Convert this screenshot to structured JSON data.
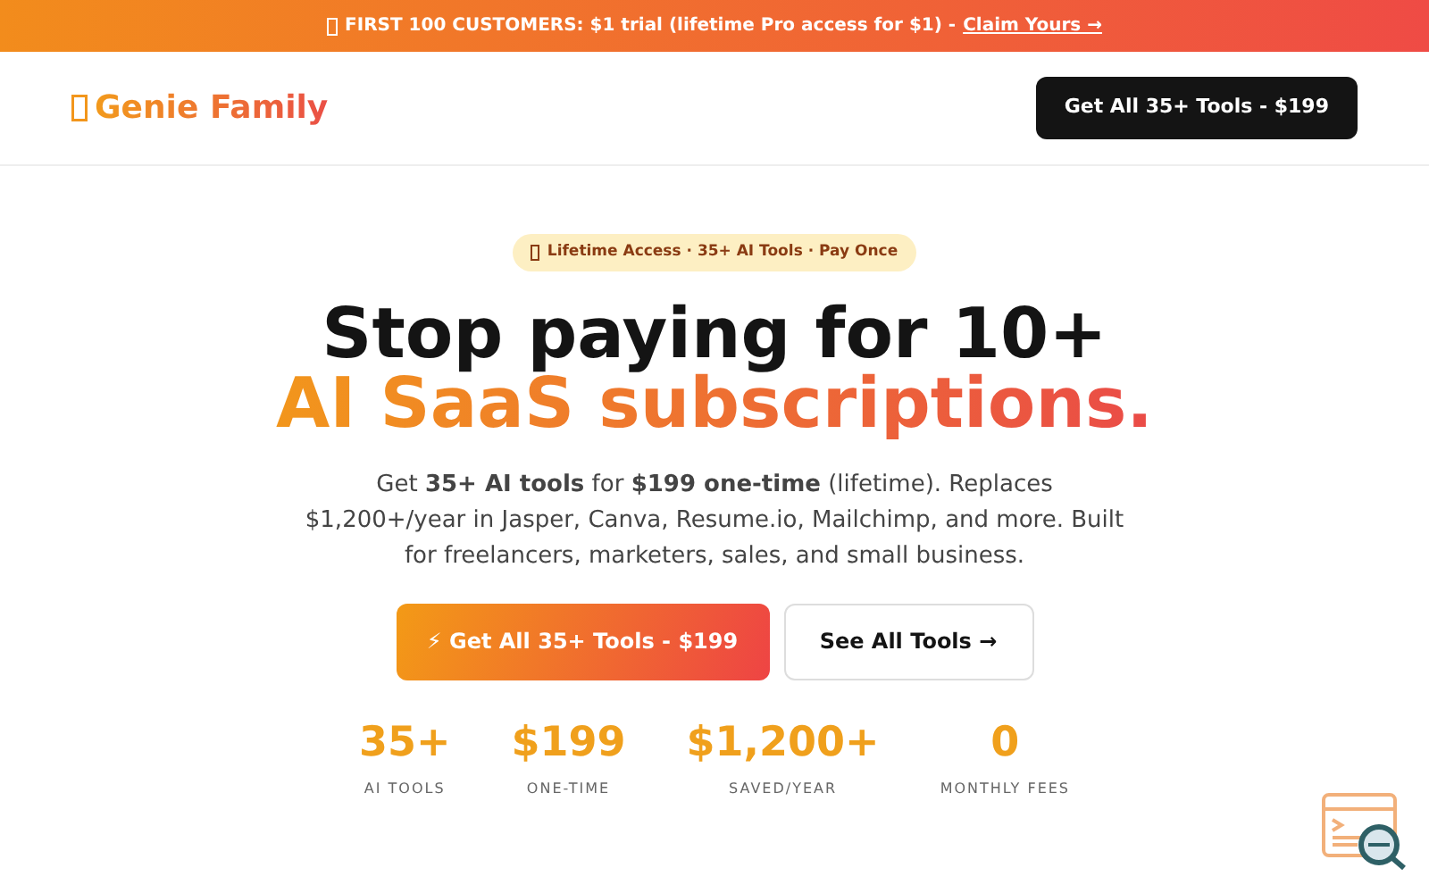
{
  "announcement": {
    "text": "FIRST 100 CUSTOMERS: $1 trial (lifetime Pro access for $1) -",
    "link": "Claim Yours →"
  },
  "header": {
    "brand": "Genie Family",
    "cta": "Get All 35+ Tools - $199"
  },
  "hero": {
    "badge": "Lifetime Access · 35+ AI Tools · Pay Once",
    "title_line_1": "Stop paying for 10+",
    "title_line_2": "AI SaaS subscriptions.",
    "description": "Get **35+ AI tools** for **$199 one-time** (lifetime). Replaces $1,200+/year in Jasper, Canva, Resume.io, Mailchimp, and more. Built for freelancers, marketers, sales, and small business.",
    "primary_button": "⚡ Get All 35+ Tools - $199",
    "secondary_button": "See All Tools →"
  },
  "stats": [
    {
      "value": "35+",
      "label": "AI TOOLS"
    },
    {
      "value": "$199",
      "label": "ONE-TIME"
    },
    {
      "value": "$1,200+",
      "label": "SAVED/YEAR"
    },
    {
      "value": "0",
      "label": "MONTHLY FEES"
    }
  ]
}
